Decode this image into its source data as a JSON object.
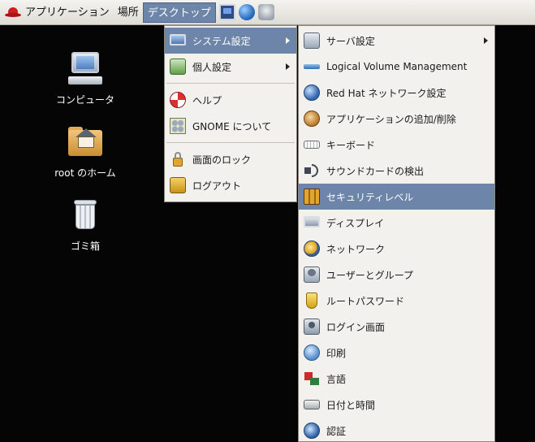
{
  "panel": {
    "menus": [
      "アプリケーション",
      "場所",
      "デスクトップ"
    ]
  },
  "desktop": {
    "icons": [
      "コンピュータ",
      "root のホーム",
      "ゴミ箱"
    ]
  },
  "desktop_menu": {
    "items": [
      "システム設定",
      "個人設定",
      "ヘルプ",
      "GNOME について",
      "画面のロック",
      "ログアウト"
    ]
  },
  "system_settings_menu": {
    "items": [
      "サーバ設定",
      "Logical Volume Management",
      "Red Hat ネットワーク設定",
      "アプリケーションの追加/削除",
      "キーボード",
      "サウンドカードの検出",
      "セキュリティレベル",
      "ディスプレイ",
      "ネットワーク",
      "ユーザーとグループ",
      "ルートパスワード",
      "ログイン画面",
      "印刷",
      "言語",
      "日付と時間",
      "認証"
    ]
  },
  "colors": {
    "highlight": "#6d85a8",
    "menu_bg": "#f2f1ed",
    "desktop_bg": "#050505"
  }
}
